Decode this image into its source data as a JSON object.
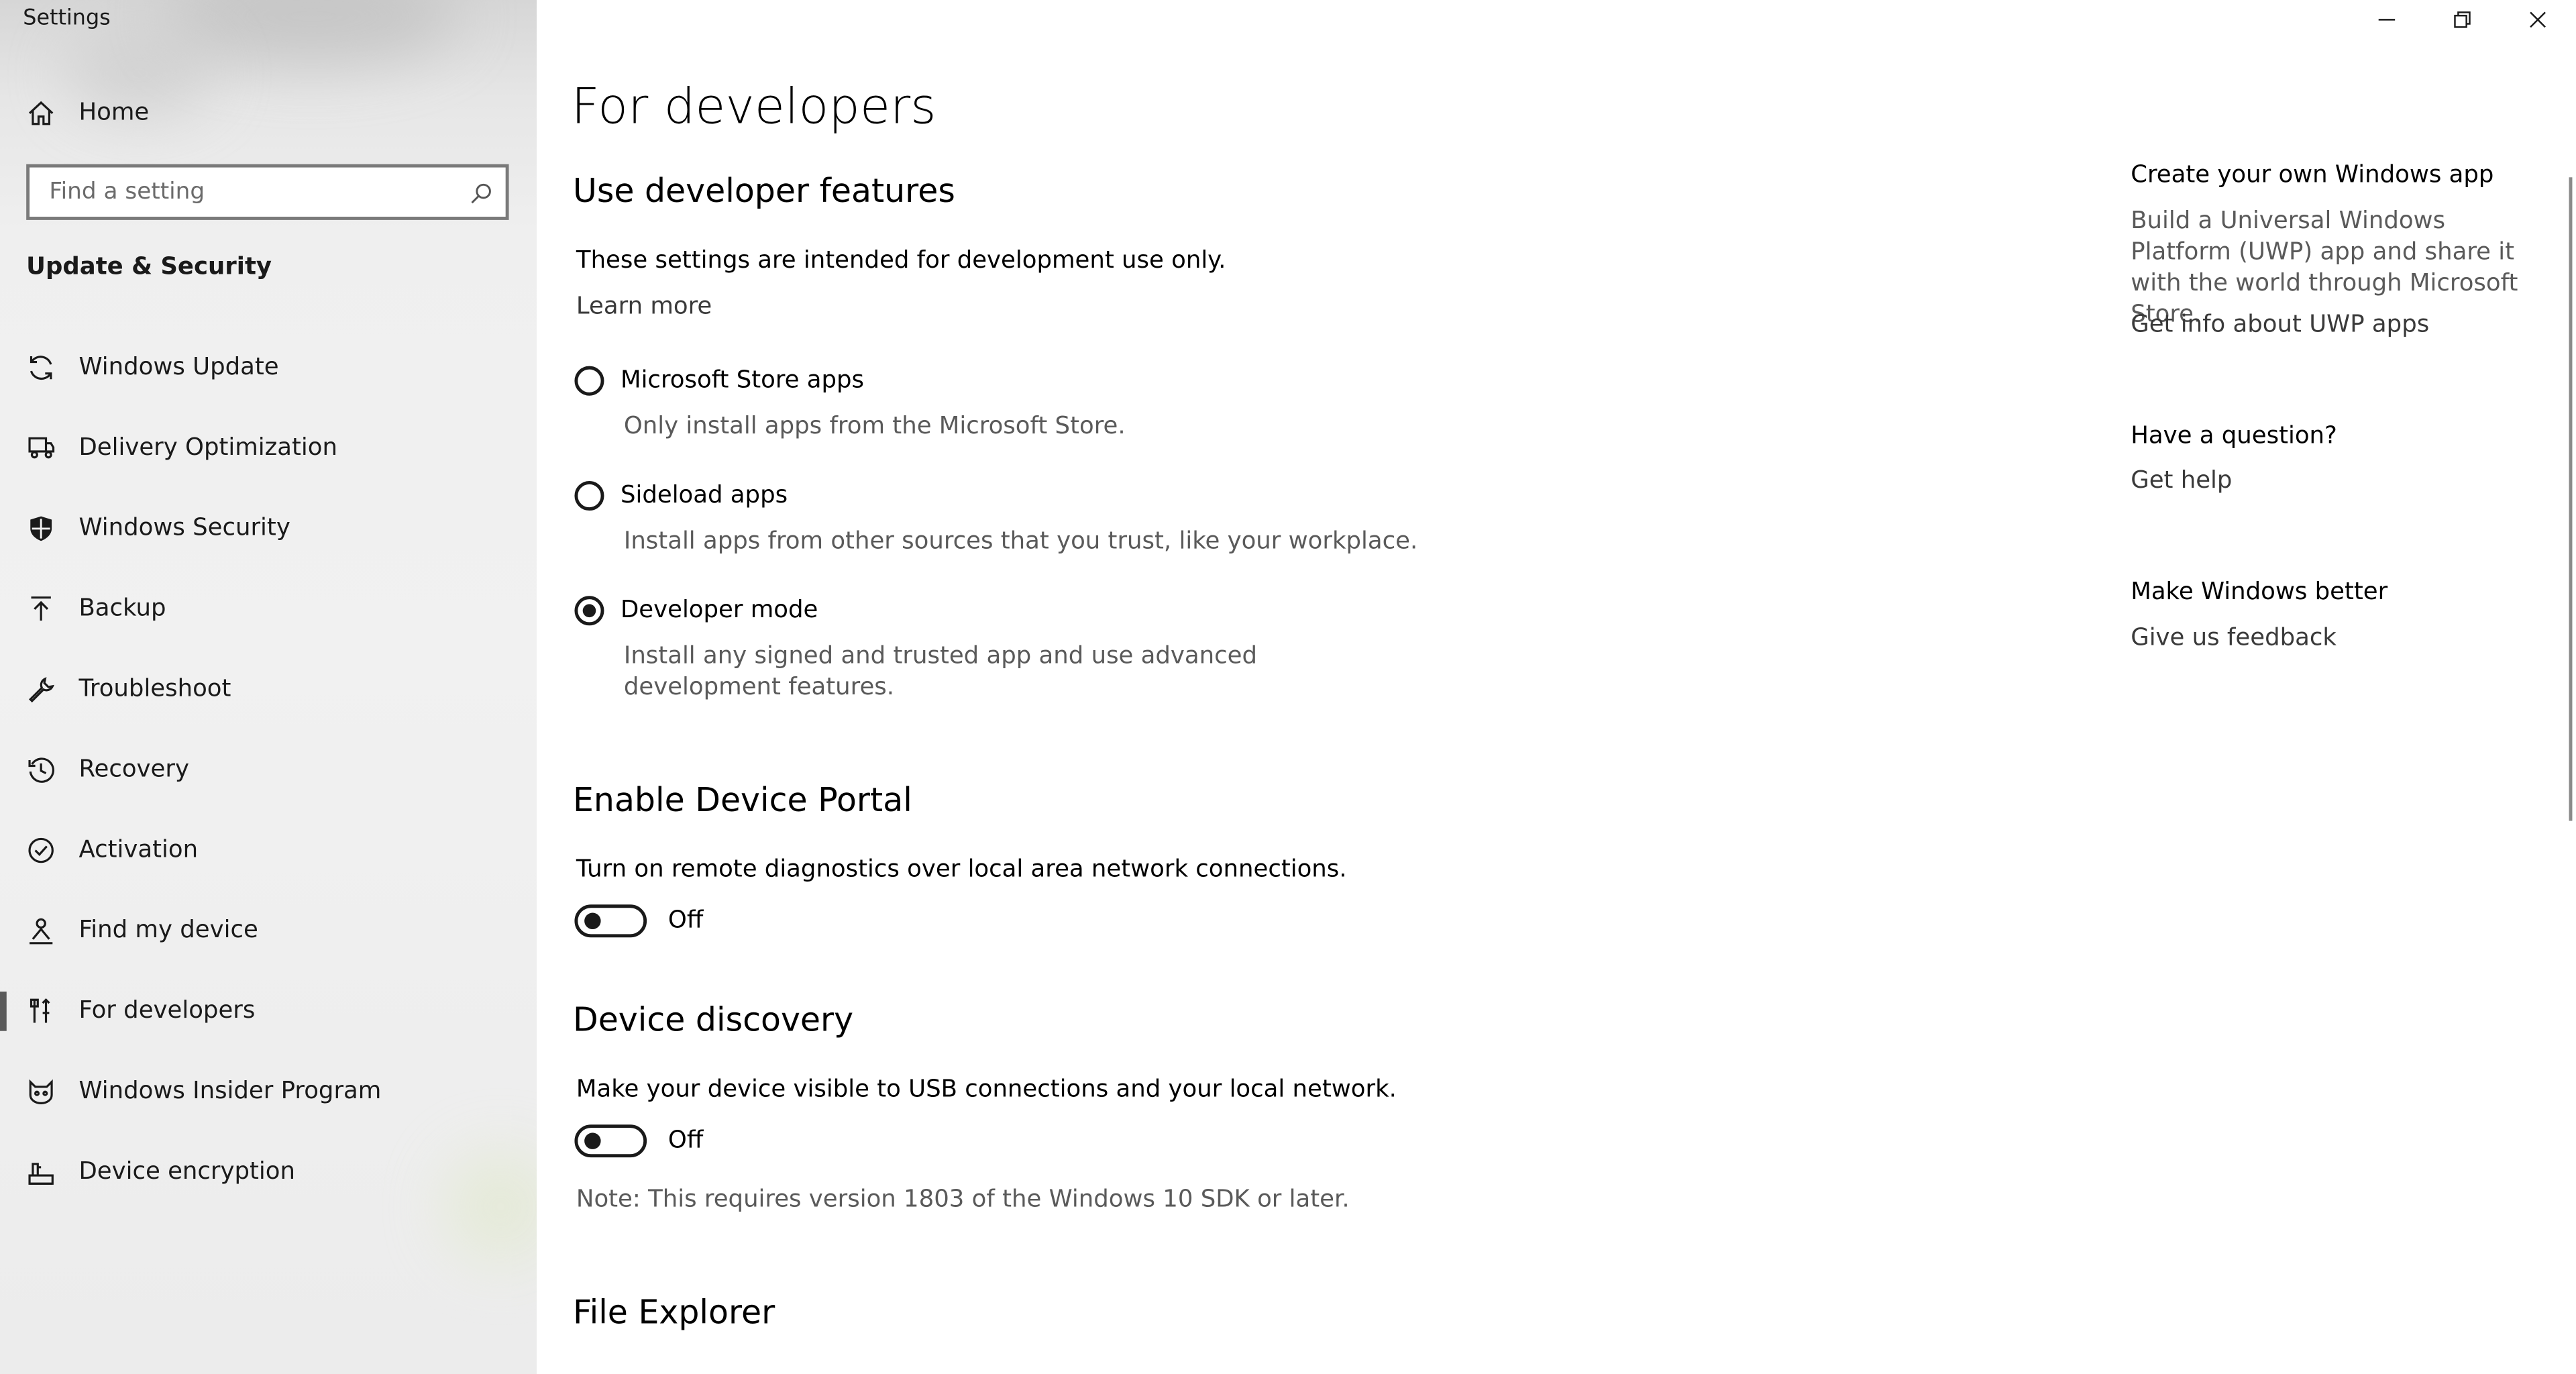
{
  "window": {
    "title": "Settings",
    "controls": [
      "minimize-icon",
      "restore-icon",
      "close-icon"
    ]
  },
  "sidebar": {
    "home_label": "Home",
    "search_placeholder": "Find a setting",
    "section_title": "Update & Security",
    "items": [
      {
        "label": "Windows Update",
        "icon": "sync-icon"
      },
      {
        "label": "Delivery Optimization",
        "icon": "delivery-optimization-icon"
      },
      {
        "label": "Windows Security",
        "icon": "shield-icon"
      },
      {
        "label": "Backup",
        "icon": "upload-arrow-icon"
      },
      {
        "label": "Troubleshoot",
        "icon": "wrench-icon"
      },
      {
        "label": "Recovery",
        "icon": "history-icon"
      },
      {
        "label": "Activation",
        "icon": "check-circle-icon"
      },
      {
        "label": "Find my device",
        "icon": "person-location-icon"
      },
      {
        "label": "For developers",
        "icon": "developer-tools-icon",
        "active": true
      },
      {
        "label": "Windows Insider Program",
        "icon": "cat-face-icon"
      },
      {
        "label": "Device encryption",
        "icon": "encryption-icon"
      }
    ]
  },
  "main": {
    "page_title": "For developers",
    "use_dev": {
      "heading": "Use developer features",
      "desc": "These settings are intended for development use only.",
      "learn_more": "Learn more",
      "options": [
        {
          "label": "Microsoft Store apps",
          "desc": "Only install apps from the Microsoft Store.",
          "checked": false
        },
        {
          "label": "Sideload apps",
          "desc": "Install apps from other sources that you trust, like your workplace.",
          "checked": false
        },
        {
          "label": "Developer mode",
          "desc": "Install any signed and trusted app and use advanced development features.",
          "checked": true
        }
      ]
    },
    "device_portal": {
      "heading": "Enable Device Portal",
      "desc": "Turn on remote diagnostics over local area network connections.",
      "toggle_state": "Off"
    },
    "device_discovery": {
      "heading": "Device discovery",
      "desc": "Make your device visible to USB connections and your local network.",
      "toggle_state": "Off",
      "note": "Note: This requires version 1803 of the Windows 10 SDK or later."
    },
    "file_explorer": {
      "heading": "File Explorer"
    }
  },
  "rail": {
    "create": {
      "heading": "Create your own Windows app",
      "desc": "Build a Universal Windows Platform (UWP) app and share it with the world through Microsoft Store.",
      "link": "Get info about UWP apps"
    },
    "question": {
      "heading": "Have a question?",
      "link": "Get help"
    },
    "better": {
      "heading": "Make Windows better",
      "link": "Give us feedback"
    }
  }
}
